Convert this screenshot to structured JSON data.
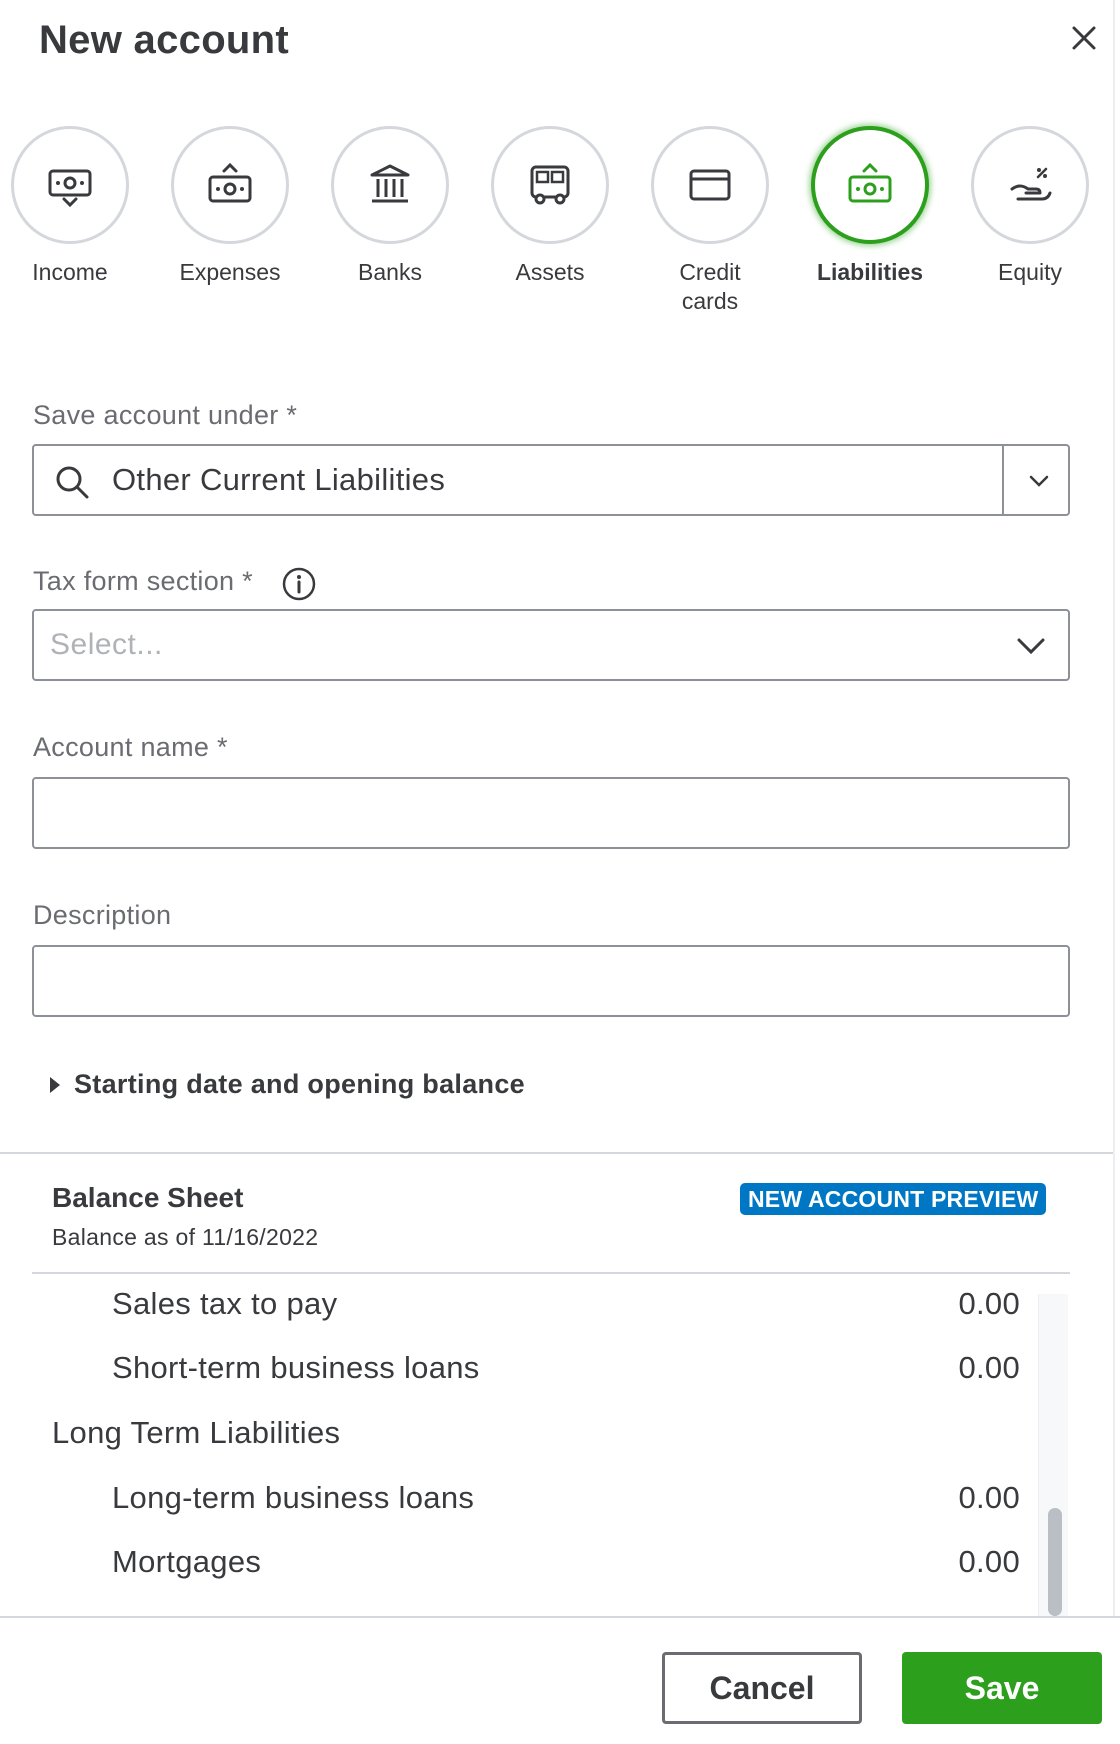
{
  "dialog": {
    "title": "New account",
    "close_icon": "close-icon"
  },
  "account_types": [
    {
      "label": "Income",
      "icon": "income-icon",
      "selected": false
    },
    {
      "label": "Expenses",
      "icon": "expenses-icon",
      "selected": false
    },
    {
      "label": "Banks",
      "icon": "bank-icon",
      "selected": false
    },
    {
      "label": "Assets",
      "icon": "assets-truck-icon",
      "selected": false
    },
    {
      "label": "Credit\ncards",
      "icon": "credit-card-icon",
      "selected": false
    },
    {
      "label": "Liabilities",
      "icon": "liabilities-icon",
      "selected": true
    },
    {
      "label": "Equity",
      "icon": "equity-icon",
      "selected": false
    }
  ],
  "colors": {
    "accent_green": "#2ca01c",
    "badge_blue": "#0077c5",
    "text": "#393a3d",
    "border": "#8d9096"
  },
  "form": {
    "save_under": {
      "label": "Save account under *",
      "value": "Other Current Liabilities"
    },
    "tax_form": {
      "label": "Tax form section *",
      "placeholder": "Select..."
    },
    "account_name": {
      "label": "Account name *",
      "value": ""
    },
    "description": {
      "label": "Description",
      "value": ""
    },
    "expander": {
      "label": "Starting date and opening balance",
      "expanded": false
    }
  },
  "balance_sheet": {
    "title": "Balance Sheet",
    "subtitle": "Balance as of 11/16/2022",
    "badge": "NEW ACCOUNT PREVIEW",
    "rows": [
      {
        "name": "Sales tax to pay",
        "amount": "0.00",
        "kind": "indent"
      },
      {
        "name": "Short-term business loans",
        "amount": "0.00",
        "kind": "indent"
      },
      {
        "name": "Long Term Liabilities",
        "amount": "",
        "kind": "group"
      },
      {
        "name": "Long-term business loans",
        "amount": "0.00",
        "kind": "indent"
      },
      {
        "name": "Mortgages",
        "amount": "0.00",
        "kind": "indent"
      }
    ]
  },
  "footer": {
    "cancel_label": "Cancel",
    "save_label": "Save"
  }
}
